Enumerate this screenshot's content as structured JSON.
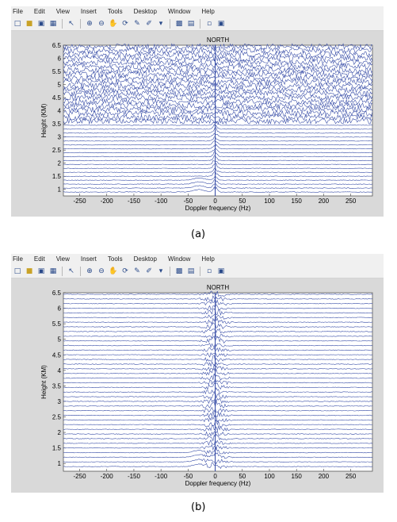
{
  "menu": [
    "File",
    "Edit",
    "View",
    "Insert",
    "Tools",
    "Desktop",
    "Window",
    "Help"
  ],
  "toolbar_icons": [
    "new-file-icon",
    "open-folder-icon",
    "save-icon",
    "print-icon",
    "pointer-icon",
    "zoom-in-icon",
    "zoom-out-icon",
    "pan-icon",
    "rotate-icon",
    "data-cursor-icon",
    "brush-icon",
    "link-icon",
    "colorbar-icon",
    "legend-icon",
    "hide-plot-tools-icon",
    "show-plot-tools-icon"
  ],
  "captions": {
    "a": "(a)",
    "b": "(b)"
  },
  "colors": {
    "trace": "#3a4fa8",
    "axes_bg": "#ffffff",
    "figure_bg": "#d9d9d9"
  },
  "chart_data": [
    {
      "type": "line",
      "title": "NORTH",
      "xlabel": "Doppler frequency (Hz)",
      "ylabel": "Height (KM)",
      "xlim": [
        -280,
        290
      ],
      "ylim": [
        0.75,
        6.5
      ],
      "xticks": [
        -250,
        -200,
        -150,
        -100,
        -50,
        0,
        50,
        100,
        150,
        200,
        250
      ],
      "yticks": [
        1,
        1.5,
        2,
        2.5,
        3,
        3.5,
        4,
        4.5,
        5,
        5.5,
        6,
        6.5
      ],
      "trace_heights_km": [
        0.9,
        1.05,
        1.2,
        1.35,
        1.5,
        1.65,
        1.8,
        1.95,
        2.1,
        2.25,
        2.4,
        2.55,
        2.7,
        2.85,
        3.0,
        3.15,
        3.3,
        3.45,
        3.6,
        3.75,
        3.9,
        4.05,
        4.2,
        4.35,
        4.5,
        4.65,
        4.8,
        4.95,
        5.1,
        5.25,
        5.4,
        5.55,
        5.7,
        5.85,
        6.0,
        6.15,
        6.3,
        6.45
      ],
      "noise_onset_km": 3.5,
      "peak_center_hz": 0,
      "grid": false
    },
    {
      "type": "line",
      "title": "NORTH",
      "xlabel": "Doppler frequency (Hz)",
      "ylabel": "Height (KM)",
      "xlim": [
        -280,
        290
      ],
      "ylim": [
        0.75,
        6.5
      ],
      "xticks": [
        -250,
        -200,
        -150,
        -100,
        -50,
        0,
        50,
        100,
        150,
        200,
        250
      ],
      "yticks": [
        1,
        1.5,
        2,
        2.5,
        3,
        3.5,
        4,
        4.5,
        5,
        5.5,
        6,
        6.5
      ],
      "trace_heights_km": [
        0.9,
        1.05,
        1.2,
        1.35,
        1.5,
        1.65,
        1.8,
        1.95,
        2.1,
        2.25,
        2.4,
        2.55,
        2.7,
        2.85,
        3.0,
        3.15,
        3.3,
        3.45,
        3.6,
        3.75,
        3.9,
        4.05,
        4.2,
        4.35,
        4.5,
        4.65,
        4.8,
        4.95,
        5.1,
        5.25,
        5.4,
        5.55,
        5.7,
        5.85,
        6.0,
        6.15,
        6.3,
        6.45
      ],
      "noise_onset_km": null,
      "peak_center_hz": 0,
      "grid": false
    }
  ]
}
